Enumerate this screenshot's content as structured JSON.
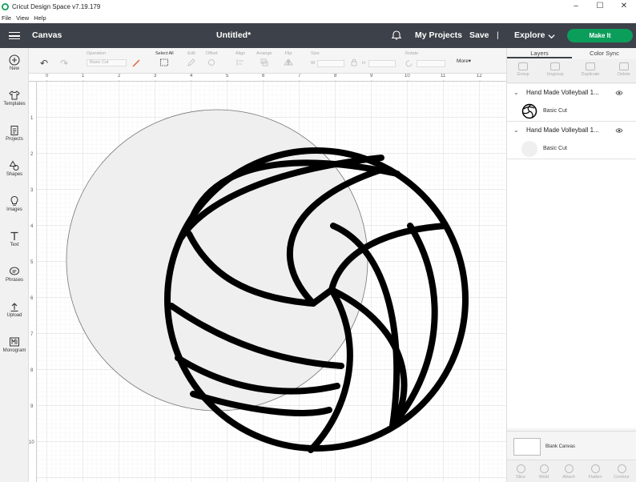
{
  "window": {
    "title": "Cricut Design Space  v7.19.179",
    "controls": {
      "minimize": "–",
      "maximize": "☐",
      "close": "✕"
    }
  },
  "menu": [
    "File",
    "View",
    "Help"
  ],
  "header": {
    "section": "Canvas",
    "doc_title": "Untitled*",
    "my_projects": "My Projects",
    "save": "Save",
    "separator": "|",
    "explore": "Explore",
    "make_it": "Make It"
  },
  "left_tools": [
    {
      "label": "New",
      "icon": "plus-circle-icon"
    },
    {
      "label": "Templates",
      "icon": "shirt-icon"
    },
    {
      "label": "Projects",
      "icon": "projects-icon"
    },
    {
      "label": "Shapes",
      "icon": "shapes-icon"
    },
    {
      "label": "Images",
      "icon": "bulb-icon"
    },
    {
      "label": "Text",
      "icon": "text-icon"
    },
    {
      "label": "Phrases",
      "icon": "speech-icon"
    },
    {
      "label": "Upload",
      "icon": "upload-icon"
    },
    {
      "label": "Monogram",
      "icon": "monogram-icon"
    }
  ],
  "options": {
    "operation_label": "Operation",
    "operation_value": "Basic Cut",
    "select_all": "Select All",
    "edit": "Edit",
    "offset": "Offset",
    "align": "Align",
    "arrange": "Arrange",
    "flip": "Flip",
    "size": "Size",
    "size_w": "W",
    "size_h": "H",
    "rotate": "Rotate",
    "more": "More▾"
  },
  "ruler_top": [
    "0",
    "1",
    "2",
    "3",
    "4",
    "5",
    "6",
    "7",
    "8",
    "9",
    "10",
    "11",
    "12"
  ],
  "ruler_left": [
    "1",
    "2",
    "3",
    "4",
    "5",
    "6",
    "7",
    "8",
    "9",
    "10"
  ],
  "right_panel": {
    "tabs": [
      "Layers",
      "Color Sync"
    ],
    "tools": [
      "Group",
      "Ungroup",
      "Duplicate",
      "Delete"
    ],
    "layers": [
      {
        "name": "Hand Made Volleyball 1...",
        "operation": "Basic Cut"
      },
      {
        "name": "Hand Made Volleyball 1...",
        "operation": "Basic Cut"
      }
    ],
    "blank_canvas": "Blank Canvas",
    "bottom_tools": [
      "Slice",
      "Weld",
      "Attach",
      "Flatten",
      "Contour"
    ]
  },
  "colors": {
    "header": "#3d4149",
    "make_it": "#0b9e5a",
    "shape_fill": "#efefef"
  }
}
